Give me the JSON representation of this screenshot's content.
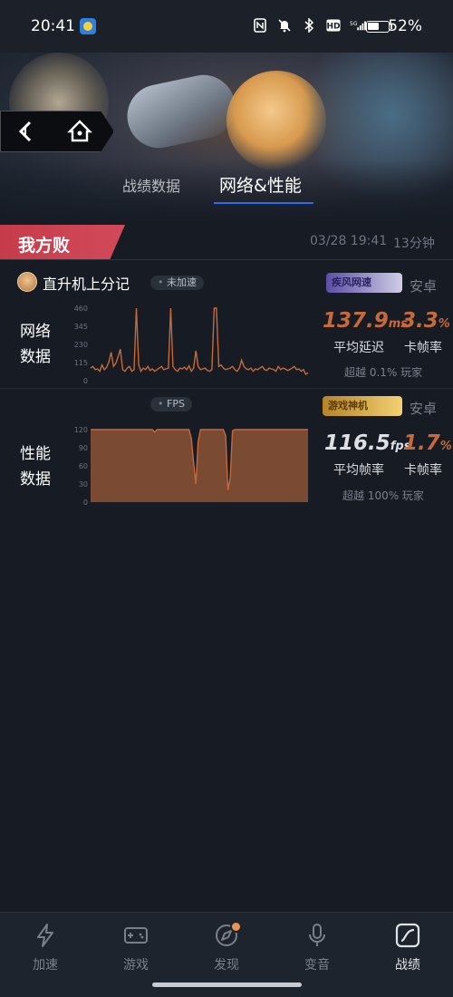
{
  "status_bar": {
    "time": "20:41",
    "battery": "52%",
    "icons": [
      "nfc-icon",
      "mute-icon",
      "bluetooth-icon",
      "hd-icon",
      "5g-signal-icon",
      "battery-icon"
    ]
  },
  "header": {
    "tabs": [
      {
        "label": "战绩数据",
        "active": false
      },
      {
        "label": "网络&性能",
        "active": true
      }
    ],
    "accent_color": "#2d6cf0"
  },
  "match": {
    "result": "我方败",
    "time": "03/28 19:41",
    "duration": "13分钟"
  },
  "player": {
    "name": "直升机上分记",
    "accel_tag": "未加速",
    "fps_tag": "FPS"
  },
  "network": {
    "section_label": "网络数据",
    "brand": "疾风网速",
    "platform": "安卓",
    "latency_value": "137.9",
    "latency_unit": "ms",
    "drop_value": "3.3",
    "drop_unit": "%",
    "latency_label": "平均延迟",
    "drop_label": "卡帧率",
    "rank": "超越 0.1% 玩家"
  },
  "performance": {
    "section_label": "性能数据",
    "brand": "游戏神机",
    "platform": "安卓",
    "fps_value": "116.5",
    "fps_unit": "fps",
    "drop_value": "1.7",
    "drop_unit": "%",
    "fps_label": "平均帧率",
    "drop_label": "卡帧率",
    "rank": "超越 100% 玩家"
  },
  "chart_data": [
    {
      "type": "area",
      "ylim": [
        0,
        460
      ],
      "yticks": [
        0,
        115,
        230,
        345,
        460
      ],
      "color": "#c56a3b",
      "values": [
        80,
        90,
        70,
        75,
        60,
        100,
        70,
        85,
        120,
        180,
        90,
        110,
        150,
        200,
        70,
        60,
        80,
        90,
        60,
        70,
        460,
        100,
        60,
        80,
        70,
        90,
        65,
        75,
        60,
        70,
        80,
        90,
        70,
        75,
        80,
        460,
        90,
        70,
        60,
        80,
        75,
        85,
        70,
        95,
        60,
        80,
        190,
        90,
        70,
        75,
        80,
        65,
        60,
        70,
        460,
        460,
        90,
        100,
        80,
        70,
        75,
        80,
        90,
        70,
        60,
        80,
        130,
        90,
        75,
        70,
        80,
        60,
        75,
        70,
        80,
        90,
        70,
        65,
        80,
        75,
        70,
        60,
        90,
        70,
        80,
        75,
        65,
        70,
        80,
        90,
        70,
        75,
        60,
        70,
        40,
        50
      ]
    },
    {
      "type": "area",
      "ylim": [
        0,
        120
      ],
      "yticks": [
        0,
        30,
        60,
        90,
        120
      ],
      "color": "#c56a3b",
      "values": [
        120,
        120,
        120,
        120,
        120,
        120,
        120,
        120,
        120,
        120,
        120,
        120,
        120,
        120,
        120,
        120,
        120,
        120,
        120,
        120,
        120,
        120,
        120,
        120,
        120,
        120,
        120,
        120,
        116,
        120,
        120,
        120,
        120,
        120,
        120,
        120,
        120,
        120,
        120,
        120,
        120,
        120,
        120,
        120,
        105,
        65,
        30,
        100,
        120,
        120,
        120,
        120,
        120,
        120,
        120,
        120,
        120,
        120,
        120,
        110,
        20,
        40,
        118,
        120,
        120,
        120,
        120,
        120,
        120,
        120,
        120,
        120,
        120,
        120,
        120,
        120,
        120,
        120,
        120,
        120,
        120,
        120,
        120,
        120,
        120,
        120,
        120,
        120,
        120,
        120,
        120,
        120,
        120,
        120,
        120,
        120
      ]
    }
  ],
  "bottom_nav": {
    "items": [
      {
        "label": "加速",
        "icon": "lightning-icon"
      },
      {
        "label": "游戏",
        "icon": "gamepad-icon"
      },
      {
        "label": "发现",
        "icon": "compass-icon"
      },
      {
        "label": "变音",
        "icon": "microphone-icon"
      },
      {
        "label": "战绩",
        "icon": "chart-icon"
      }
    ]
  }
}
